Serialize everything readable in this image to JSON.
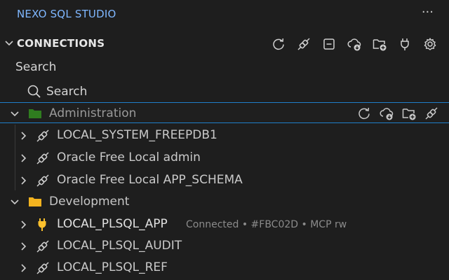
{
  "app": {
    "title": "NEXO SQL STUDIO",
    "more_icon": "ellipsis-icon"
  },
  "section": {
    "title": "CONNECTIONS",
    "toolbar": [
      {
        "name": "refresh-icon"
      },
      {
        "name": "disconnect-icon"
      },
      {
        "name": "collapse-all-icon"
      },
      {
        "name": "cloud-download-icon"
      },
      {
        "name": "new-folder-icon"
      },
      {
        "name": "plug-icon"
      },
      {
        "name": "gear-icon"
      }
    ]
  },
  "search": {
    "label": "Search",
    "placeholder": "Search"
  },
  "tree": {
    "administration": {
      "label": "Administration",
      "folder_color": "#2f7d1f",
      "connections": [
        {
          "label": "LOCAL_SYSTEM_FREEPDB1"
        },
        {
          "label": "Oracle Free Local admin"
        },
        {
          "label": "Oracle Free Local APP_SCHEMA"
        }
      ]
    },
    "development": {
      "label": "Development",
      "folder_color": "#f2b21f",
      "connections": [
        {
          "label": "LOCAL_PLSQL_APP",
          "meta": "Connected • #FBC02D • MCP rw",
          "plug_color": "#FBC02D"
        },
        {
          "label": "LOCAL_PLSQL_AUDIT"
        },
        {
          "label": "LOCAL_PLSQL_REF"
        }
      ]
    }
  }
}
